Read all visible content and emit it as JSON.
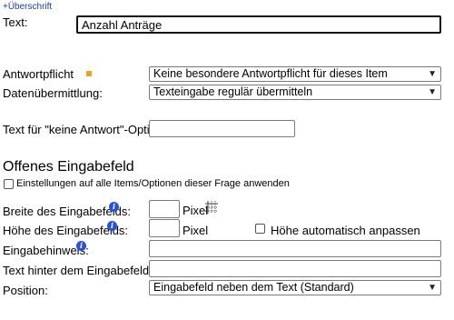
{
  "header": {
    "add_heading_link": "+Überschrift"
  },
  "text_field": {
    "label": "Text:",
    "value": "Anzahl Anträge"
  },
  "answer_required": {
    "label": "Antwortpflicht",
    "selected": "Keine besondere Antwortpflicht für dieses Item (Einstellung aus der Frage)"
  },
  "data_transfer": {
    "label": "Datenübermittlung:",
    "selected": "Texteingabe regulär übermitteln"
  },
  "no_answer_option": {
    "label": "Text für \"keine Antwort\"-Option:",
    "value": ""
  },
  "section": {
    "title": "Offenes Eingabefeld",
    "apply_all_label": "Einstellungen auf alle Items/Optionen dieser Frage anwenden"
  },
  "width_field": {
    "label": "Breite des Eingabefelds:",
    "unit": "Pixel",
    "value": ""
  },
  "height_field": {
    "label": "Höhe des Eingabefelds:",
    "unit": "Pixel",
    "value": "",
    "auto_label": "Höhe automatisch anpassen"
  },
  "hint_field": {
    "label": "Eingabehinweis:",
    "value": ""
  },
  "after_text_field": {
    "label": "Text hinter dem Eingabefeld:",
    "value": ""
  },
  "position_field": {
    "label": "Position:",
    "selected": "Eingabefeld neben dem Text (Standard)"
  },
  "icons": {
    "info": "info-icon",
    "required": "required-star-icon",
    "resize": "resize-grid-icon",
    "dropdown": "chevron-down-icon"
  },
  "colors": {
    "link": "#1a3fa6",
    "info_icon": "#2a52d8",
    "required_marker": "#f0a020"
  }
}
